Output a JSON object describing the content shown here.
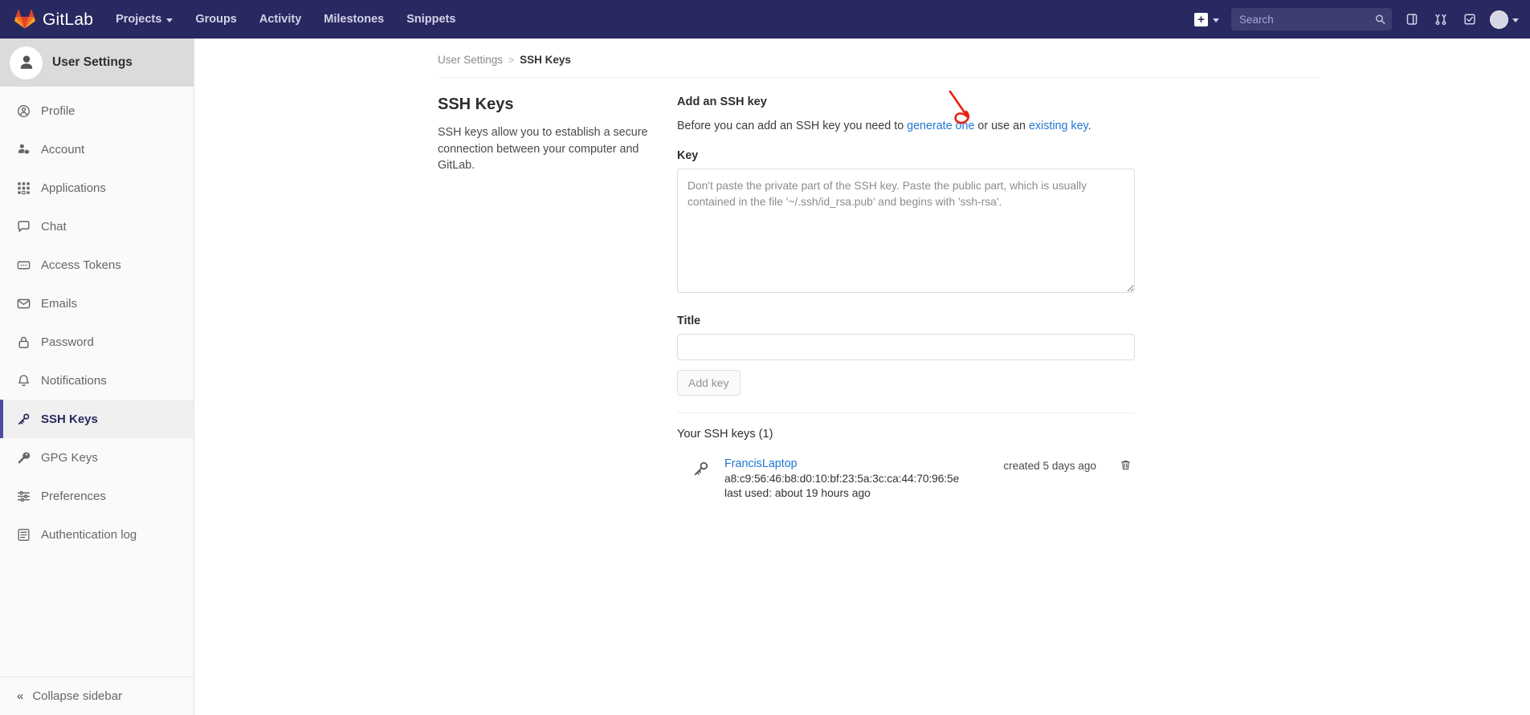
{
  "navbar": {
    "brand": "GitLab",
    "items": [
      {
        "label": "Projects",
        "has_caret": true
      },
      {
        "label": "Groups",
        "has_caret": false
      },
      {
        "label": "Activity",
        "has_caret": false
      },
      {
        "label": "Milestones",
        "has_caret": false
      },
      {
        "label": "Snippets",
        "has_caret": false
      }
    ],
    "new_dropdown_icon": "plus-icon",
    "search": {
      "value": "",
      "placeholder": "Search"
    },
    "icons": [
      {
        "name": "issues-icon"
      },
      {
        "name": "merge-requests-icon"
      },
      {
        "name": "todos-icon"
      }
    ],
    "avatar": "user-avatar",
    "bg_color": "#292961"
  },
  "sidebar": {
    "header": {
      "title": "User Settings",
      "avatar": "user-avatar"
    },
    "items": [
      {
        "label": "Profile",
        "icon": "profile-icon",
        "active": false
      },
      {
        "label": "Account",
        "icon": "account-icon",
        "active": false
      },
      {
        "label": "Applications",
        "icon": "applications-icon",
        "active": false
      },
      {
        "label": "Chat",
        "icon": "chat-icon",
        "active": false
      },
      {
        "label": "Access Tokens",
        "icon": "access-tokens-icon",
        "active": false
      },
      {
        "label": "Emails",
        "icon": "email-icon",
        "active": false
      },
      {
        "label": "Password",
        "icon": "lock-icon",
        "active": false
      },
      {
        "label": "Notifications",
        "icon": "bell-icon",
        "active": false
      },
      {
        "label": "SSH Keys",
        "icon": "key-icon",
        "active": true
      },
      {
        "label": "GPG Keys",
        "icon": "key-icon",
        "active": false
      },
      {
        "label": "Preferences",
        "icon": "sliders-icon",
        "active": false
      },
      {
        "label": "Authentication log",
        "icon": "log-icon",
        "active": false
      }
    ],
    "collapse": {
      "label": "Collapse sidebar",
      "icon": "chevron-double-left-icon"
    },
    "active_accent_color": "#4b4ba3"
  },
  "breadcrumb": {
    "parent": "User Settings",
    "separator": ">",
    "current": "SSH Keys"
  },
  "page": {
    "section_title": "SSH Keys",
    "section_desc": "SSH keys allow you to establish a secure connection between your computer and GitLab."
  },
  "form": {
    "heading": "Add an SSH key",
    "sub_before": "Before you can add an SSH key you need to ",
    "link_generate": "generate one",
    "sub_middle": " or use an ",
    "link_existing": "existing key",
    "sub_end": ".",
    "key_label": "Key",
    "key_value": "",
    "key_placeholder": "Don't paste the private part of the SSH key. Paste the public part, which is usually contained in the file '~/.ssh/id_rsa.pub' and begins with 'ssh-rsa'.",
    "title_label": "Title",
    "title_value": "",
    "title_placeholder": "",
    "submit_label": "Add key",
    "link_color": "#1f78d1"
  },
  "keys_list": {
    "heading": "Your SSH keys (1)",
    "count": 1,
    "rows": [
      {
        "icon": "key-icon",
        "name": "FrancisLaptop",
        "fingerprint": "a8:c9:56:46:b8:d0:10:bf:23:5a:3c:ca:44:70:96:5e",
        "last_used": "last used: about 19 hours ago",
        "created": "created 5 days ago",
        "delete_icon": "trash-icon"
      }
    ]
  },
  "annotation": {
    "type": "arrow",
    "color": "#e8200f",
    "points_at": "generate one"
  }
}
